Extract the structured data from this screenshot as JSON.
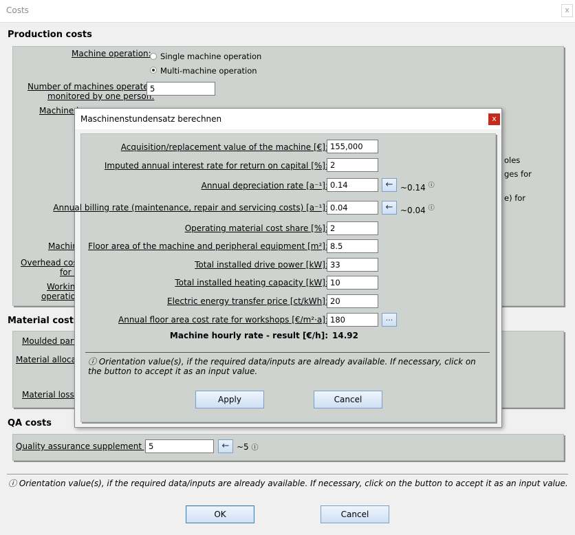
{
  "window": {
    "title": "Costs",
    "close": "x"
  },
  "production": {
    "heading": "Production costs",
    "machine_operation_label": "Machine operation:",
    "radio_single": "Single machine operation",
    "radio_multi": "Multi-machine operation",
    "machines_label_1": "Number of machines operated/",
    "machines_label_2": "monitored by one person:",
    "machines_value": "5",
    "machine_h_label": "Machine h",
    "partial_right_1": "oles",
    "partial_right_2": "ges for",
    "partial_right_3": "e) for",
    "machin_label": "Machin",
    "overhead_1": "Overhead cost",
    "overhead_2": "for v",
    "working_1": "Working",
    "working_2": "operation"
  },
  "material": {
    "heading": "Material costs",
    "moulded": "Moulded part",
    "allocation": "Material allocatio",
    "loss": "Material loss s"
  },
  "qa": {
    "heading": "QA costs",
    "supplement_label": "Quality assurance supplement [%]:",
    "supplement_value": "5",
    "hint": "~5",
    "arrow": "←",
    "info": "ⓘ"
  },
  "footer": {
    "note": "ⓘ Orientation value(s), if the required data/inputs are already available. If necessary, click on the button to accept it as an input value.",
    "ok": "OK",
    "cancel": "Cancel"
  },
  "dialog": {
    "title": "Maschinenstundensatz berechnen",
    "close": "x",
    "fields": {
      "acquisition": {
        "label": "Acquisition/replacement value of the machine [€]:",
        "value": "155,000"
      },
      "interest": {
        "label": "Imputed annual interest rate for return on capital [%]:",
        "value": "2"
      },
      "depreciation": {
        "label": "Annual depreciation rate [a⁻¹]:",
        "value": "0.14",
        "hint": "~0.14"
      },
      "billing": {
        "label": "Annual billing rate (maintenance, repair and servicing costs) [a⁻¹]:",
        "value": "0.04",
        "hint": "~0.04"
      },
      "operating": {
        "label": "Operating material cost share [%]:",
        "value": "2"
      },
      "floor_area": {
        "label": "Floor area of the machine and peripheral equipment [m²]:",
        "value": "8.5"
      },
      "drive_power": {
        "label": "Total installed drive power [kW]:",
        "value": "33"
      },
      "heating": {
        "label": "Total installed heating capacity [kW]:",
        "value": "10"
      },
      "energy_price": {
        "label": "Electric energy transfer price [ct/kWh]:",
        "value": "20"
      },
      "floor_cost": {
        "label": "Annual floor area cost rate for workshops [€/m²·a]:",
        "value": "180",
        "button": "..."
      }
    },
    "arrow": "←",
    "info": "ⓘ",
    "result_label": "Machine hourly rate - result [€/h]:",
    "result_value": "14.92",
    "note": "ⓘ Orientation value(s), if the required data/inputs are already available. If necessary, click on the button to accept it as an input value.",
    "apply": "Apply",
    "cancel": "Cancel"
  }
}
